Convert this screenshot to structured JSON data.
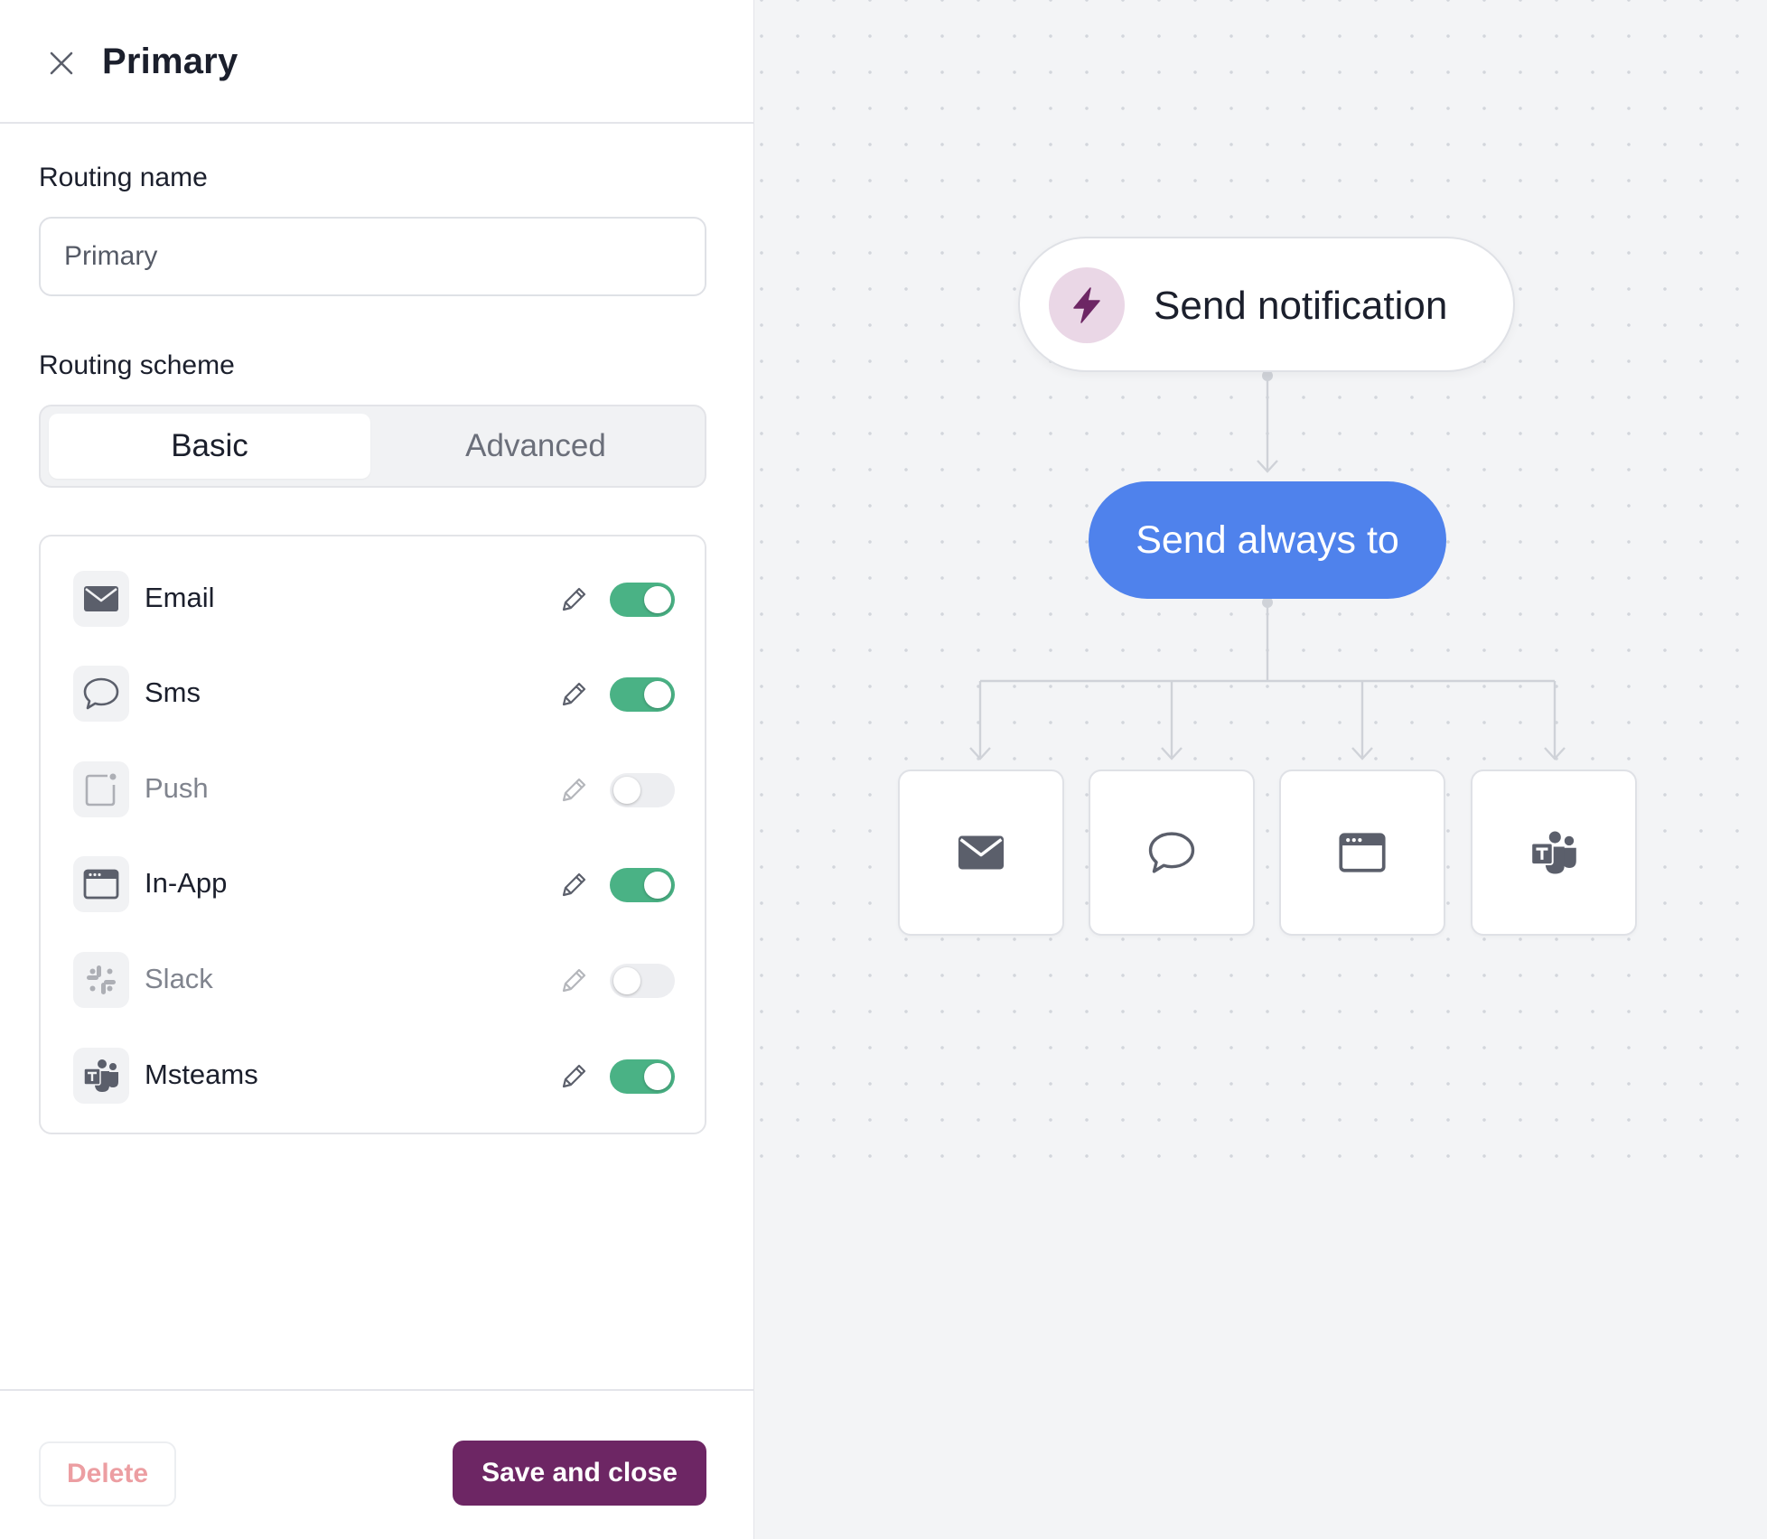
{
  "panel": {
    "title": "Primary",
    "routing_name_label": "Routing name",
    "routing_name_value": "Primary",
    "routing_scheme_label": "Routing scheme",
    "scheme_tabs": [
      "Basic",
      "Advanced"
    ],
    "selected_tab": "Basic",
    "channels": [
      {
        "label": "Email",
        "icon": "envelope-icon",
        "enabled": true
      },
      {
        "label": "Sms",
        "icon": "chat-bubble-icon",
        "enabled": true
      },
      {
        "label": "Push",
        "icon": "mobile-notification-icon",
        "enabled": false
      },
      {
        "label": "In-App",
        "icon": "browser-window-icon",
        "enabled": true
      },
      {
        "label": "Slack",
        "icon": "slack-icon",
        "enabled": false
      },
      {
        "label": "Msteams",
        "icon": "msteams-icon",
        "enabled": true
      }
    ],
    "delete_label": "Delete",
    "save_label": "Save and close"
  },
  "canvas": {
    "trigger_label": "Send notification",
    "route_label": "Send always to",
    "channel_nodes": [
      "envelope-icon",
      "chat-bubble-icon",
      "browser-window-icon",
      "msteams-icon"
    ]
  },
  "colors": {
    "brand": "#6d2664",
    "route_node": "#4f82ec",
    "toggle_on": "#4ab285",
    "delete_text": "#ec9ea2"
  }
}
